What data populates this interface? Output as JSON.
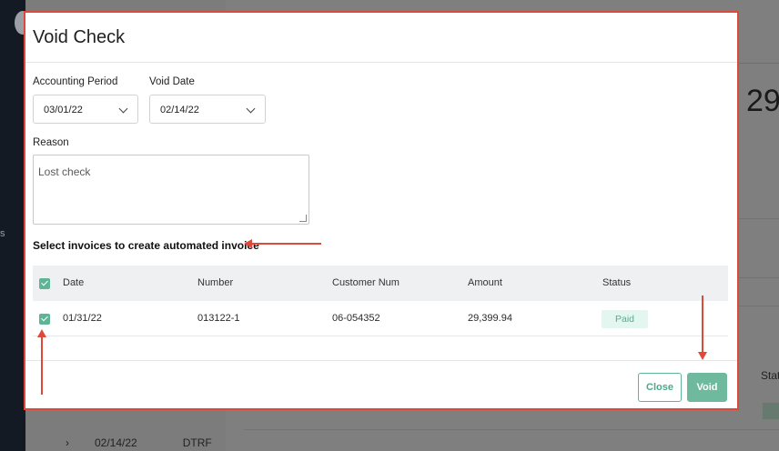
{
  "background": {
    "amount_fragment": "29,",
    "status_header_fragment": "Stat",
    "sidebar_fragment": "s",
    "bottom_row": {
      "date": "02/14/22",
      "code": "DTRF"
    }
  },
  "modal": {
    "title": "Void Check",
    "accounting_period": {
      "label": "Accounting Period",
      "value": "03/01/22"
    },
    "void_date": {
      "label": "Void Date",
      "value": "02/14/22"
    },
    "reason": {
      "label": "Reason",
      "value": "Lost check"
    },
    "section_title": "Select invoices to create automated invoice",
    "table": {
      "headers": [
        "Date",
        "Number",
        "Customer Num",
        "Amount",
        "Status"
      ],
      "rows": [
        {
          "date": "01/31/22",
          "number": "013122-1",
          "customer_num": "06-054352",
          "amount": "29,399.94",
          "status": "Paid"
        }
      ]
    },
    "buttons": {
      "close": "Close",
      "void": "Void"
    }
  },
  "colors": {
    "accent": "#5fb496",
    "annotation": "#e0493a",
    "paid_bg": "#e3f6ef"
  }
}
